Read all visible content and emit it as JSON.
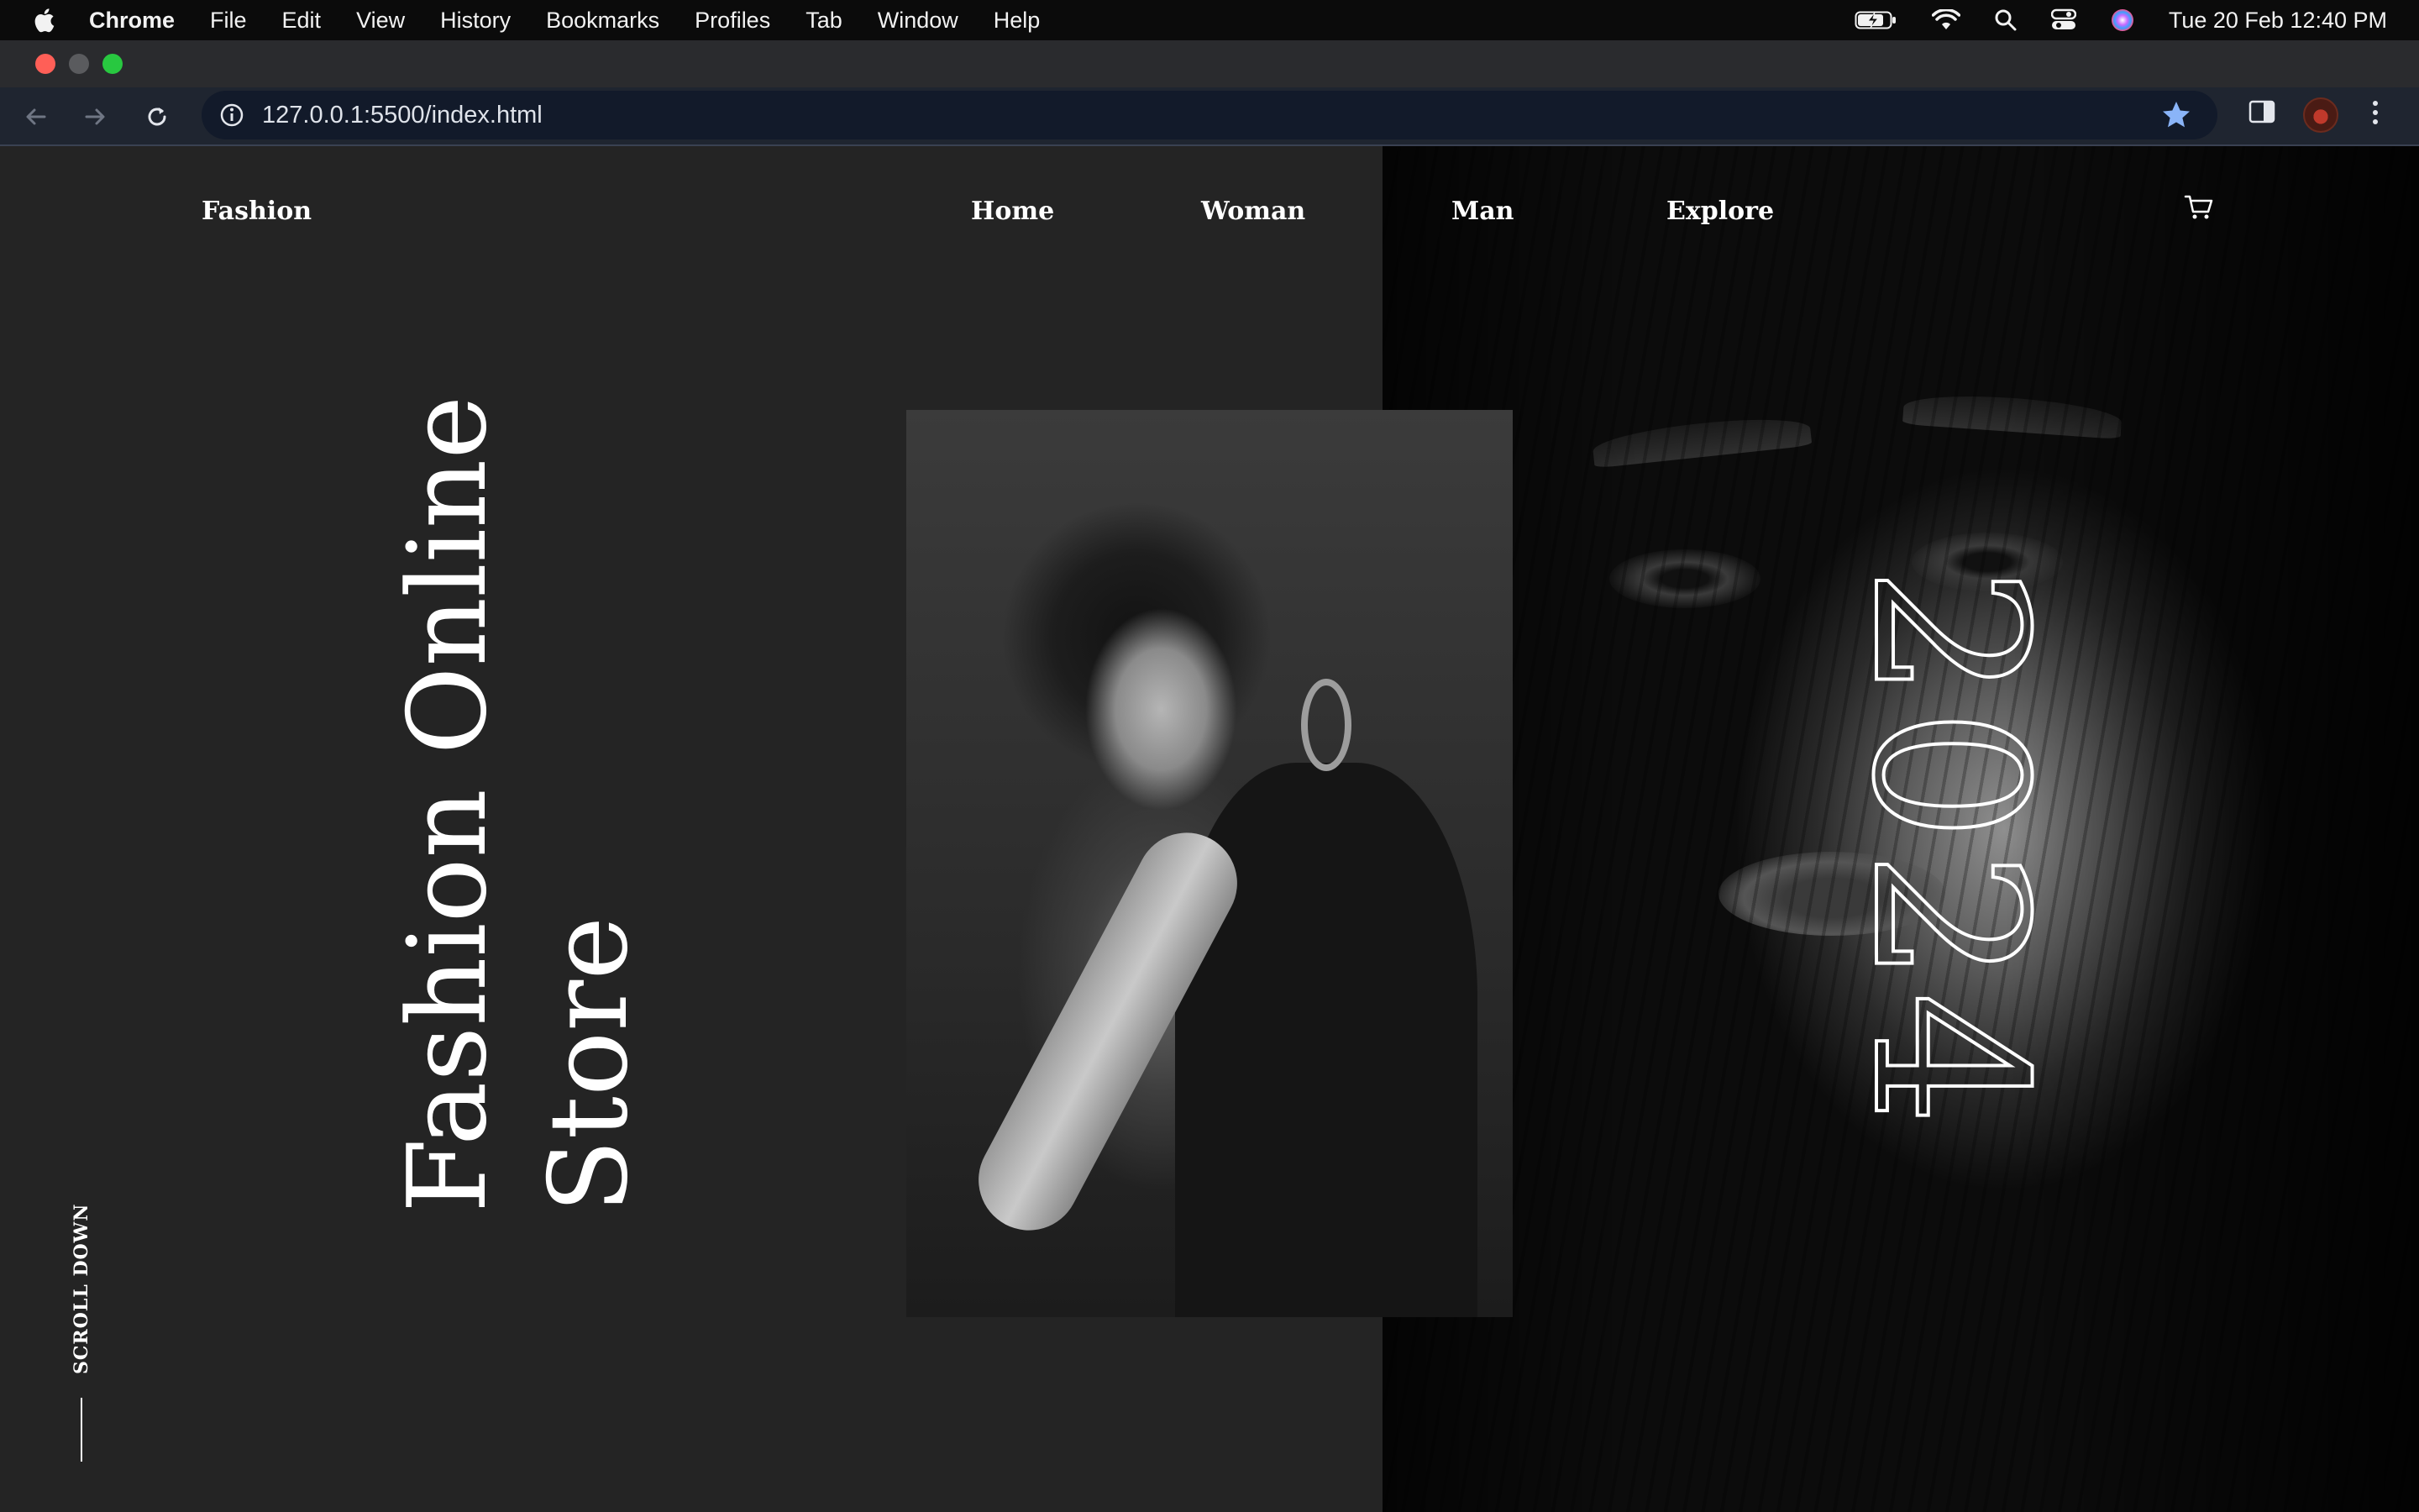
{
  "menubar": {
    "app_name": "Chrome",
    "items": [
      "File",
      "Edit",
      "View",
      "History",
      "Bookmarks",
      "Profiles",
      "Tab",
      "Window",
      "Help"
    ],
    "datetime": "Tue 20 Feb  12:40 PM",
    "status_icons": [
      "battery-charging-icon",
      "wifi-icon",
      "spotlight-search-icon",
      "control-center-icon",
      "siri-icon"
    ]
  },
  "browser": {
    "url": "127.0.0.1:5500/index.html",
    "bookmarked": true
  },
  "site": {
    "brand": "Fashion",
    "nav": [
      "Home",
      "Woman",
      "Man",
      "Explore"
    ],
    "headline_line1": "Fashion Online",
    "headline_line2": "Store",
    "year": "2024",
    "scroll_label": "SCROLL DOWN"
  },
  "colors": {
    "page_bg": "#242424",
    "text": "#ffffff",
    "menubar_bg": "#0b0b0b",
    "toolbar_bg": "#1f2530",
    "omnibox_bg": "#121a2a",
    "star_accent": "#8ab4f8"
  }
}
